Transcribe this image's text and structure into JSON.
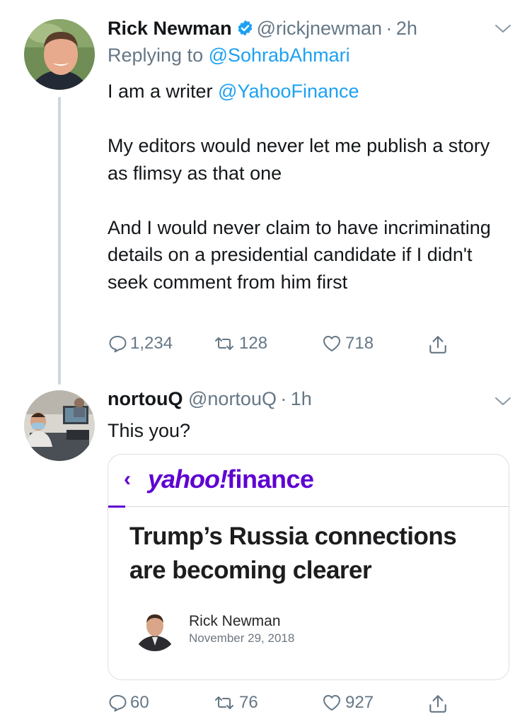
{
  "tweets": [
    {
      "author_name": "Rick Newman",
      "handle": "@rickjnewman",
      "separator": "·",
      "time": "2h",
      "replying_prefix": "Replying to",
      "replying_to": "@SohrabAhmari",
      "body": {
        "line1_text": "I am a writer ",
        "line1_mention": "@YahooFinance",
        "para2": "My editors would never let me publish a story as flimsy as that one",
        "para3": "And I would never claim to have incriminating details on a presidential candidate if I didn't seek comment from him first"
      },
      "counts": {
        "replies": "1,234",
        "retweets": "128",
        "likes": "718"
      },
      "icons": [
        "verified-badge-icon",
        "chevron-down-icon",
        "reply-icon",
        "retweet-icon",
        "like-icon",
        "share-icon"
      ],
      "colors": {
        "verified": "#1da1f2",
        "link": "#1da1f2",
        "secondary": "#657786"
      }
    },
    {
      "author_name": "nortouQ",
      "handle": "@nortouQ",
      "separator": "·",
      "time": "1h",
      "body": {
        "text": "This you?"
      },
      "counts": {
        "replies": "60",
        "retweets": "76",
        "likes": "927"
      },
      "embedded_card": {
        "back_glyph": "‹",
        "brand_part1": "yahoo!",
        "brand_part2": "finance",
        "headline": "Trump’s Russia connections are becoming clearer",
        "author": "Rick Newman",
        "date": "November 29, 2018",
        "colors": {
          "brand": "#5f01d1"
        }
      }
    }
  ]
}
